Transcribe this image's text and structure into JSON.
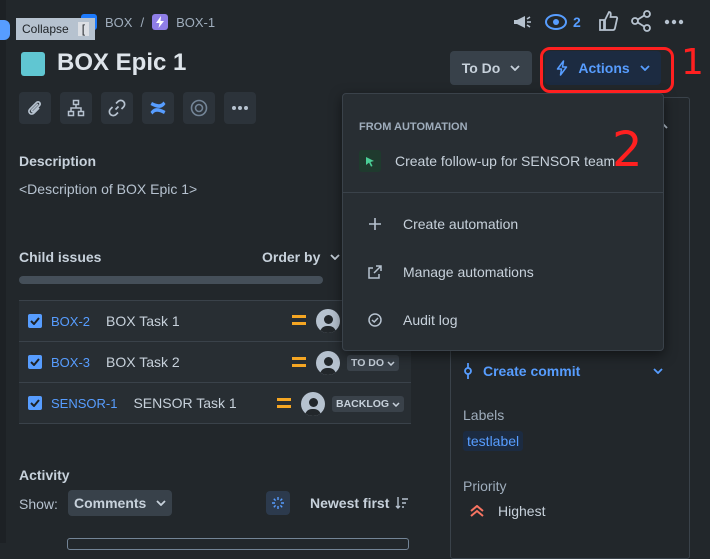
{
  "tooltip": {
    "label": "Collapse",
    "key": "["
  },
  "breadcrumb": {
    "project": "BOX",
    "separator": "/",
    "issue": "BOX-1"
  },
  "header": {
    "watch_count": "2"
  },
  "issue": {
    "title": "BOX Epic 1"
  },
  "status_button": {
    "label": "To Do"
  },
  "actions_button": {
    "label": "Actions"
  },
  "description": {
    "heading": "Description",
    "text": "<Description of BOX Epic 1>"
  },
  "child_issues": {
    "heading": "Child issues",
    "order_by": "Order by",
    "rows": [
      {
        "key": "BOX-2",
        "summary": "BOX Task 1",
        "status": ""
      },
      {
        "key": "BOX-3",
        "summary": "BOX Task 2",
        "status": "TO DO"
      },
      {
        "key": "SENSOR-1",
        "summary": "SENSOR Task 1",
        "status": "BACKLOG"
      }
    ]
  },
  "activity": {
    "heading": "Activity",
    "show_label": "Show:",
    "filter": "Comments",
    "sort": "Newest first"
  },
  "sidebar": {
    "create_commit": "Create commit",
    "labels_heading": "Labels",
    "label_tag": "testlabel",
    "priority_heading": "Priority",
    "priority_value": "Highest"
  },
  "actions_menu": {
    "section_heading": "FROM AUTOMATION",
    "items": [
      {
        "label": "Create follow-up for SENSOR team"
      },
      {
        "label": "Create automation"
      },
      {
        "label": "Manage automations"
      },
      {
        "label": "Audit log"
      }
    ]
  },
  "annotations": {
    "one": "1",
    "two": "2"
  },
  "colors": {
    "background": "#22272b",
    "link": "#579dff",
    "priority": "#f87462",
    "medium_priority": "#f5a623",
    "annotation": "#ff2020"
  }
}
